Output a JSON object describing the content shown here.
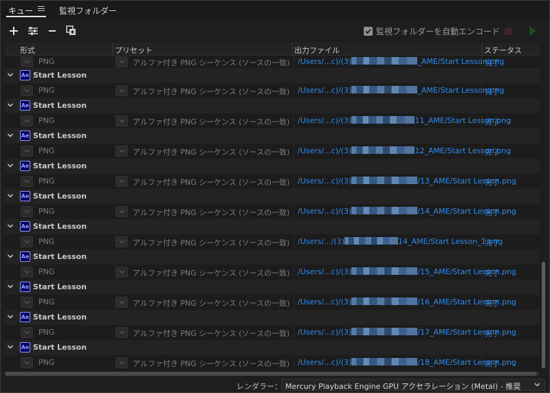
{
  "tabs": {
    "queue_label": "キュー",
    "watch_label": "監視フォルダー"
  },
  "toolbar": {
    "add_icon": "plus-icon",
    "settings_icon": "sliders-icon",
    "remove_icon": "minus-icon",
    "duplicate_icon": "duplicate-icon",
    "auto_encode_label": "監視フォルダーを自動エンコード",
    "auto_encode_checked": true
  },
  "table": {
    "headers": {
      "format": "形式",
      "preset": "プリセット",
      "output": "出力ファイル",
      "status": "ステータス"
    },
    "first_output": {
      "format": "PNG",
      "preset": "アルファ付き PNG シーケンス (ソースの一致)",
      "output_prefix": "/Users/...c)/(3)",
      "output_suffix": "_AME/Start Lesson.png",
      "status": "完了"
    },
    "groups": [
      {
        "name": "Start Lesson",
        "format": "PNG",
        "preset": "アルファ付き PNG シーケンス (ソースの一致)",
        "output_prefix": "/Users/...c)/(3)",
        "output_suffix": "_AME/Start Lesson.png",
        "status": "完了"
      },
      {
        "name": "Start Lesson",
        "format": "PNG",
        "preset": "アルファ付き PNG シーケンス (ソースの一致)",
        "output_prefix": "/Users/...c)/(3)",
        "output_suffix": "11_AME/Start Lesson.png",
        "status": "完了"
      },
      {
        "name": "Start Lesson",
        "format": "PNG",
        "preset": "アルファ付き PNG シーケンス (ソースの一致)",
        "output_prefix": "/Users/...c)/(3)",
        "output_suffix": "12_AME/Start Lesson.png",
        "status": "完了"
      },
      {
        "name": "Start Lesson",
        "format": "PNG",
        "preset": "アルファ付き PNG シーケンス (ソースの一致)",
        "output_prefix": "/Users/...c)/(3)",
        "output_suffix": "/13_AME/Start Lesson.png",
        "status": "完了"
      },
      {
        "name": "Start Lesson",
        "format": "PNG",
        "preset": "アルファ付き PNG シーケンス (ソースの一致)",
        "output_prefix": "/Users/...c)/(3)",
        "output_suffix": "/14_AME/Start Lesson.png",
        "status": "完了"
      },
      {
        "name": "Start Lesson",
        "format": "PNG",
        "preset": "アルファ付き PNG シーケンス (ソースの一致)",
        "output_prefix": "/Users/.../(3)",
        "output_suffix": "14_AME/Start Lesson_1.png",
        "status": "完了"
      },
      {
        "name": "Start Lesson",
        "format": "PNG",
        "preset": "アルファ付き PNG シーケンス (ソースの一致)",
        "output_prefix": "/Users/...c)/(3)",
        "output_suffix": "/15_AME/Start Lesson.png",
        "status": "完了"
      },
      {
        "name": "Start Lesson",
        "format": "PNG",
        "preset": "アルファ付き PNG シーケンス (ソースの一致)",
        "output_prefix": "/Users/...c)/(3)",
        "output_suffix": "/16_AME/Start Lesson.png",
        "status": "完了"
      },
      {
        "name": "Start Lesson",
        "format": "PNG",
        "preset": "アルファ付き PNG シーケンス (ソースの一致)",
        "output_prefix": "/Users/...c)/(3)",
        "output_suffix": "/17_AME/Start Lesson.png",
        "status": "完了"
      },
      {
        "name": "Start Lesson",
        "format": "PNG",
        "preset": "アルファ付き PNG シーケンス (ソースの一致)",
        "output_prefix": "/Users/...c)/(3)",
        "output_suffix": "/18_AME/Start Lesson.png",
        "status": "完了"
      }
    ],
    "app_icon_label": "Ae"
  },
  "footer": {
    "renderer_label": "レンダラー：",
    "renderer_value": "Mercury Playback Engine GPU アクセラレーション (Metal) - 推奨"
  },
  "colors": {
    "link": "#2f8cf0",
    "ae_icon_bg": "#00005b",
    "ae_icon_fg": "#9999ff"
  }
}
